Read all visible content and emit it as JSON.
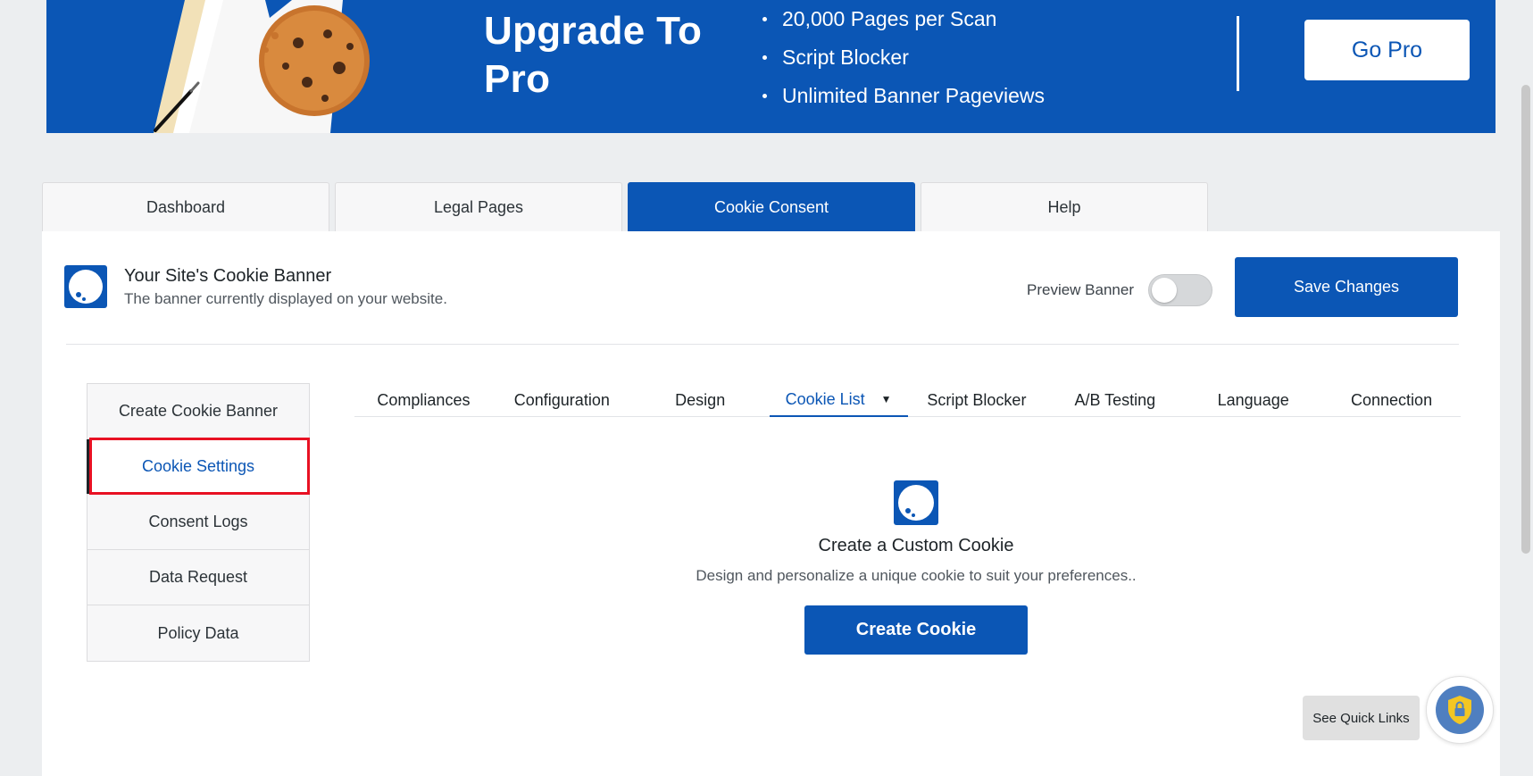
{
  "promo": {
    "title": "Upgrade To Pro",
    "features": [
      "20,000 Pages per Scan",
      "Script Blocker",
      "Unlimited Banner Pageviews"
    ],
    "cta_label": "Go Pro"
  },
  "main_tabs": [
    {
      "label": "Dashboard",
      "active": false
    },
    {
      "label": "Legal Pages",
      "active": false
    },
    {
      "label": "Cookie Consent",
      "active": true
    },
    {
      "label": "Help",
      "active": false
    }
  ],
  "banner_header": {
    "title": "Your Site's Cookie Banner",
    "subtitle": "The banner currently displayed on your website.",
    "preview_label": "Preview Banner",
    "preview_on": false,
    "save_label": "Save Changes"
  },
  "side_menu": [
    {
      "label": "Create Cookie Banner",
      "active": false
    },
    {
      "label": "Cookie Settings",
      "active": true
    },
    {
      "label": "Consent Logs",
      "active": false
    },
    {
      "label": "Data Request",
      "active": false
    },
    {
      "label": "Policy Data",
      "active": false
    }
  ],
  "sub_tabs": [
    {
      "label": "Compliances",
      "active": false
    },
    {
      "label": "Configuration",
      "active": false
    },
    {
      "label": "Design",
      "active": false
    },
    {
      "label": "Cookie List",
      "active": true
    },
    {
      "label": "Script Blocker",
      "active": false
    },
    {
      "label": "A/B Testing",
      "active": false
    },
    {
      "label": "Language",
      "active": false
    },
    {
      "label": "Connection",
      "active": false
    }
  ],
  "empty_state": {
    "title": "Create a Custom Cookie",
    "description": "Design and personalize a unique cookie to suit your preferences..",
    "button_label": "Create Cookie"
  },
  "quick_links_label": "See Quick Links",
  "colors": {
    "brand": "#0b56b5",
    "highlight": "#e81123",
    "page_bg": "#eceef0"
  }
}
